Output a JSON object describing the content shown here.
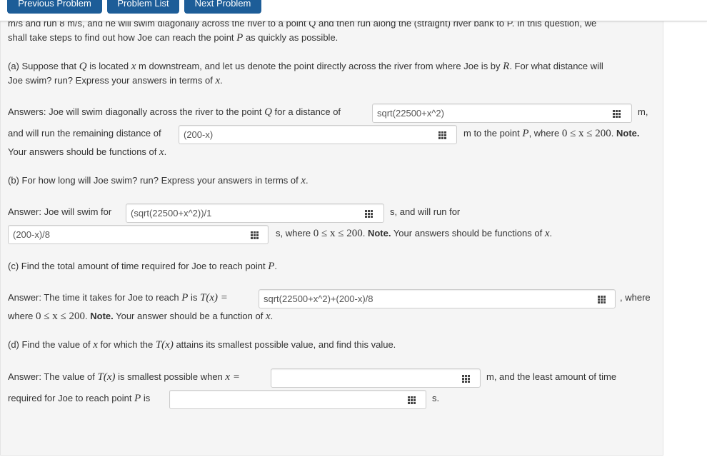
{
  "nav": {
    "previous": "Previous Problem",
    "list": "Problem List",
    "next": "Next Problem"
  },
  "intro": {
    "line1": "m/s and run 8 m/s, and he will swim diagonally across the river to a point Q and then run along the (straight) river bank to P. In this question, we",
    "line2a": "shall take steps to find out how Joe can reach the point ",
    "P": "P",
    "line2b": " as quickly as possible."
  },
  "part_a": {
    "q1a": "(a) Suppose that ",
    "Q": "Q",
    "q1b": " is located ",
    "x": "x",
    "q1c": " m downstream, and let us denote the point directly across the river from where Joe is by ",
    "R": "R",
    "q1d": ". For what distance will",
    "q2a": "Joe swim? run? Express your answers in terms of ",
    "q2b": ".",
    "ans1a": "Answers: Joe will swim diagonally across the river to the point ",
    "ans1b": " for a distance of",
    "field1": "sqrt(22500+x^2)",
    "unit1": "m,",
    "ans2a": "and will run the remaining distance of",
    "field2": "(200-x)",
    "ans2b": "m to the point ",
    "ans2c": ", where ",
    "ineq": "0 ≤ x ≤ 200",
    "ans2d": ". ",
    "note": "Note.",
    "ans3a": "Your answers should be functions of ",
    "ans3b": "."
  },
  "part_b": {
    "q1a": "(b) For how long will Joe swim? run? Express your answers in terms of ",
    "q1b": ".",
    "ans1": "Answer: Joe will swim for",
    "field1": "(sqrt(22500+x^2))/1",
    "ans1b": "s, and will run for",
    "field2": "(200-x)/8",
    "ans2a": "s, where ",
    "ineq": "0 ≤ x ≤ 200",
    "ans2b": ". ",
    "note": "Note.",
    "ans2c": " Your answers should be functions of ",
    "ans2d": "."
  },
  "part_c": {
    "q1a": "(c) Find the total amount of time required for Joe to reach point ",
    "P": "P",
    "q1b": ".",
    "ans1a": "Answer: The time it takes for Joe to reach ",
    "ans1b": " is ",
    "Tx": "T(x) =",
    "field1": "sqrt(22500+x^2)+(200-x)/8",
    "ans1c": ", where",
    "ans2a": "where ",
    "ineq": "0 ≤ x ≤ 200",
    "ans2b": ". ",
    "note": "Note.",
    "ans2c": " Your answer should be a function of ",
    "ans2d": "."
  },
  "part_d": {
    "q1a": "(d) Find the value of ",
    "x": "x",
    "q1b": " for which the ",
    "Tx": "T(x)",
    "q1c": " attains its smallest possible value, and find this value.",
    "ans1a": "Answer: The value of ",
    "ans1b": " is smallest possible when ",
    "xeq": "x =",
    "field1": "",
    "ans1c": "m, and the least amount of time",
    "ans2a": "required for Joe to reach point ",
    "ans2b": " is",
    "field2": "",
    "ans2c": "s."
  }
}
